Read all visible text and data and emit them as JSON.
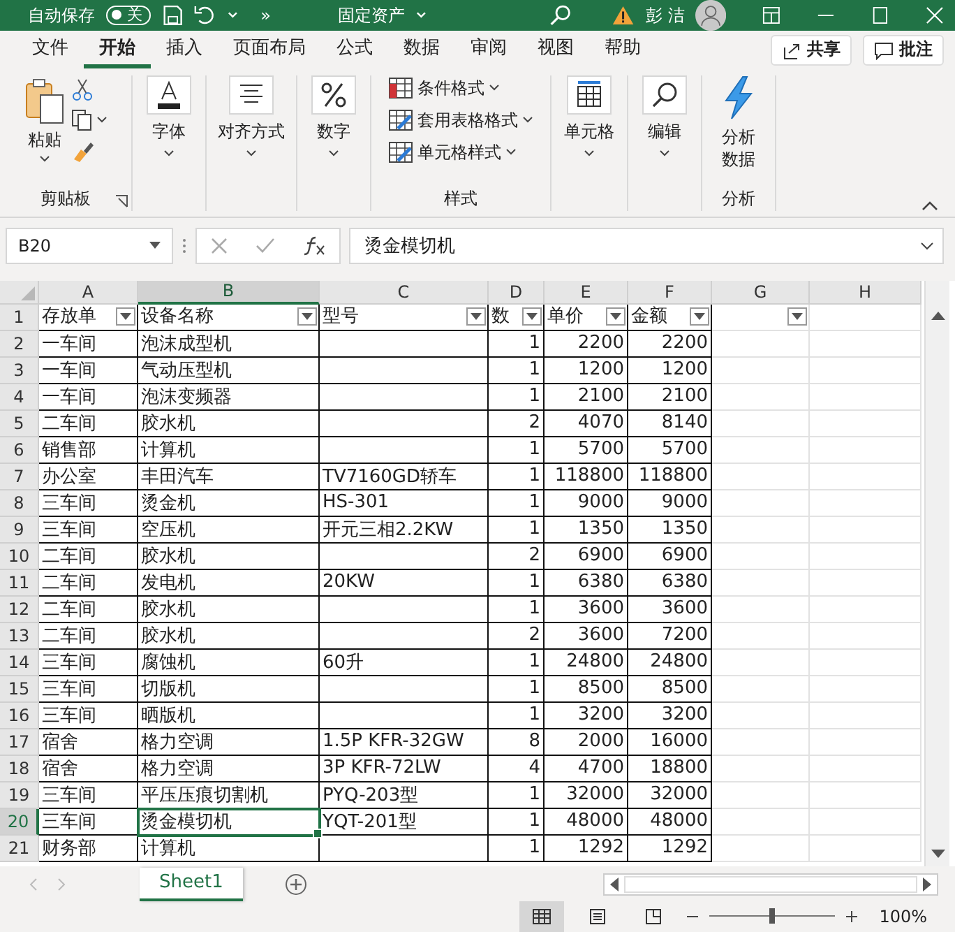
{
  "title_bar": {
    "autosave_label": "自动保存",
    "autosave": {
      "label": "关",
      "on": false
    },
    "more": "»",
    "file_title": "固定资产",
    "user_name": "彭 洁"
  },
  "menu_tabs": [
    {
      "label": "文件",
      "selected": false
    },
    {
      "label": "开始",
      "selected": true
    },
    {
      "label": "插入",
      "selected": false
    },
    {
      "label": "页面布局",
      "selected": false
    },
    {
      "label": "公式",
      "selected": false
    },
    {
      "label": "数据",
      "selected": false
    },
    {
      "label": "审阅",
      "selected": false
    },
    {
      "label": "视图",
      "selected": false
    },
    {
      "label": "帮助",
      "selected": false
    }
  ],
  "share_button": "共享",
  "comment_button": "批注",
  "ribbon": [
    {
      "kind": "clipboard",
      "label": "剪贴板",
      "items": [
        "粘贴"
      ]
    },
    {
      "kind": "dropdown",
      "items": [
        "字体"
      ]
    },
    {
      "kind": "dropdown",
      "items": [
        "对齐方式"
      ]
    },
    {
      "kind": "dropdown",
      "items": [
        "数字"
      ]
    },
    {
      "kind": "list",
      "label": "样式",
      "items": [
        "条件格式",
        "套用表格格式",
        "单元格样式"
      ]
    },
    {
      "kind": "dropdown",
      "items": [
        "单元格"
      ]
    },
    {
      "kind": "dropdown",
      "items": [
        "编辑"
      ]
    },
    {
      "kind": "action",
      "label": "分析",
      "items": [
        "分析数据"
      ]
    }
  ],
  "name_box": "B20",
  "formula": "烫金模切机",
  "columns": [
    {
      "letter": "A",
      "filter": true,
      "selected": false
    },
    {
      "letter": "B",
      "filter": true,
      "selected": true
    },
    {
      "letter": "C",
      "filter": true,
      "selected": false
    },
    {
      "letter": "D",
      "filter": true,
      "selected": false
    },
    {
      "letter": "E",
      "filter": true,
      "selected": false
    },
    {
      "letter": "F",
      "filter": true,
      "selected": false
    },
    {
      "letter": "G",
      "filter": true,
      "selected": false
    },
    {
      "letter": "H",
      "filter": false,
      "selected": false
    }
  ],
  "rows": [
    {
      "number": "1",
      "kind": "header",
      "selected": false,
      "cells": {
        "A": "存放单",
        "B": "设备名称",
        "C": "型号",
        "D": "数",
        "E": "单价",
        "F": "金额"
      }
    },
    {
      "number": "2",
      "kind": "data",
      "selected": false,
      "cells": {
        "A": "一车间",
        "B": "泡沫成型机",
        "D": "1",
        "E": "2200",
        "F": "2200"
      }
    },
    {
      "number": "3",
      "kind": "data",
      "selected": false,
      "cells": {
        "A": "一车间",
        "B": "气动压型机",
        "D": "1",
        "E": "1200",
        "F": "1200"
      }
    },
    {
      "number": "4",
      "kind": "data",
      "selected": false,
      "cells": {
        "A": "一车间",
        "B": "泡沫变频器",
        "D": "1",
        "E": "2100",
        "F": "2100"
      }
    },
    {
      "number": "5",
      "kind": "data",
      "selected": false,
      "cells": {
        "A": "二车间",
        "B": "胶水机",
        "D": "2",
        "E": "4070",
        "F": "8140"
      }
    },
    {
      "number": "6",
      "kind": "data",
      "selected": false,
      "cells": {
        "A": "销售部",
        "B": "计算机",
        "D": "1",
        "E": "5700",
        "F": "5700"
      }
    },
    {
      "number": "7",
      "kind": "data",
      "selected": false,
      "cells": {
        "A": "办公室",
        "B": "丰田汽车",
        "C": "TV7160GD轿车",
        "D": "1",
        "E": "118800",
        "F": "118800"
      }
    },
    {
      "number": "8",
      "kind": "data",
      "selected": false,
      "cells": {
        "A": "三车间",
        "B": "烫金机",
        "C": "HS-301",
        "D": "1",
        "E": "9000",
        "F": "9000"
      }
    },
    {
      "number": "9",
      "kind": "data",
      "selected": false,
      "cells": {
        "A": "三车间",
        "B": "空压机",
        "C": "开元三相2.2KW",
        "D": "1",
        "E": "1350",
        "F": "1350"
      }
    },
    {
      "number": "10",
      "kind": "data",
      "selected": false,
      "cells": {
        "A": "二车间",
        "B": "胶水机",
        "D": "2",
        "E": "6900",
        "F": "6900"
      }
    },
    {
      "number": "11",
      "kind": "data",
      "selected": false,
      "cells": {
        "A": "二车间",
        "B": "发电机",
        "C": "20KW",
        "D": "1",
        "E": "6380",
        "F": "6380"
      }
    },
    {
      "number": "12",
      "kind": "data",
      "selected": false,
      "cells": {
        "A": "二车间",
        "B": "胶水机",
        "D": "1",
        "E": "3600",
        "F": "3600"
      }
    },
    {
      "number": "13",
      "kind": "data",
      "selected": false,
      "cells": {
        "A": "二车间",
        "B": "胶水机",
        "D": "2",
        "E": "3600",
        "F": "7200"
      }
    },
    {
      "number": "14",
      "kind": "data",
      "selected": false,
      "cells": {
        "A": "三车间",
        "B": "腐蚀机",
        "C": "60升",
        "D": "1",
        "E": "24800",
        "F": "24800"
      }
    },
    {
      "number": "15",
      "kind": "data",
      "selected": false,
      "cells": {
        "A": "三车间",
        "B": "切版机",
        "D": "1",
        "E": "8500",
        "F": "8500"
      }
    },
    {
      "number": "16",
      "kind": "data",
      "selected": false,
      "cells": {
        "A": "三车间",
        "B": "晒版机",
        "D": "1",
        "E": "3200",
        "F": "3200"
      }
    },
    {
      "number": "17",
      "kind": "data",
      "selected": false,
      "cells": {
        "A": "宿舍",
        "B": "格力空调",
        "C": "1.5P KFR-32GW",
        "D": "8",
        "E": "2000",
        "F": "16000"
      }
    },
    {
      "number": "18",
      "kind": "data",
      "selected": false,
      "cells": {
        "A": "宿舍",
        "B": "格力空调",
        "C": "3P KFR-72LW",
        "D": "4",
        "E": "4700",
        "F": "18800"
      }
    },
    {
      "number": "19",
      "kind": "data",
      "selected": false,
      "cells": {
        "A": "三车间",
        "B": "平压压痕切割机",
        "C": "PYQ-203型",
        "D": "1",
        "E": "32000",
        "F": "32000"
      }
    },
    {
      "number": "20",
      "kind": "data",
      "selected": true,
      "cells": {
        "A": "三车间",
        "B": "烫金模切机",
        "C": "YQT-201型",
        "D": "1",
        "E": "48000",
        "F": "48000"
      }
    },
    {
      "number": "21",
      "kind": "data",
      "selected": false,
      "cells": {
        "A": "财务部",
        "B": "计算机",
        "D": "1",
        "E": "1292",
        "F": "1292"
      }
    }
  ],
  "sheet_tabs": [
    {
      "label": "Sheet1",
      "selected": true
    }
  ],
  "status_bar": {
    "views": [
      {
        "kind": "normal",
        "selected": true
      },
      {
        "kind": "page_layout",
        "selected": false
      },
      {
        "kind": "page_break",
        "selected": false
      }
    ],
    "zoom": {
      "level": 0.5,
      "reading": "100%"
    }
  }
}
